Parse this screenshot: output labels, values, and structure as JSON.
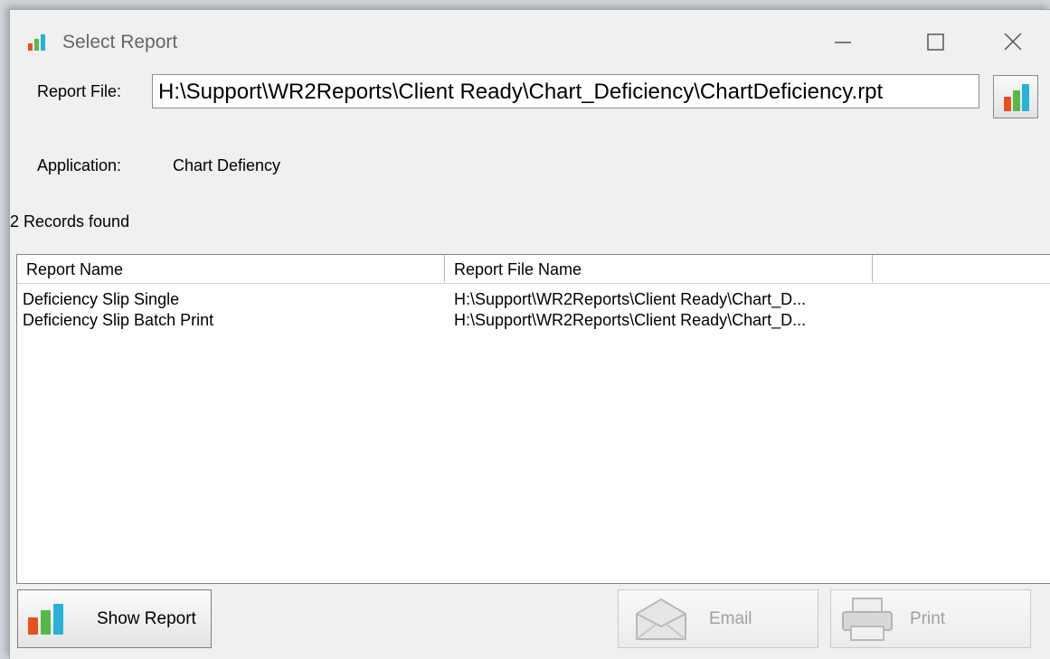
{
  "window": {
    "title": "Select Report",
    "icon": "bar-chart-icon",
    "controls": [
      "minimize-icon",
      "maximize-icon",
      "close-icon"
    ]
  },
  "report_file": {
    "label": "Report File:",
    "value": "H:\\Support\\WR2Reports\\Client Ready\\Chart_Deficiency\\ChartDeficiency.rpt",
    "browse_icon": "bar-chart-icon"
  },
  "application": {
    "label": "Application:",
    "value": "Chart Defiency"
  },
  "records_status": "2 Records found",
  "report_list": {
    "columns": [
      "Report Name",
      "Report File Name",
      ""
    ],
    "rows": [
      {
        "name": "Deficiency Slip Single",
        "file": "H:\\Support\\WR2Reports\\Client Ready\\Chart_D..."
      },
      {
        "name": "Deficiency Slip Batch Print",
        "file": "H:\\Support\\WR2Reports\\Client Ready\\Chart_D..."
      }
    ]
  },
  "buttons": {
    "show_report": "Show Report",
    "email": "Email",
    "print": "Print"
  },
  "colors": {
    "window_bg": "#f0f0f0",
    "chart_orange": "#e8501e",
    "chart_green": "#56b947",
    "chart_cyan": "#2ab1d6",
    "disabled_text": "#a0a0a0"
  }
}
